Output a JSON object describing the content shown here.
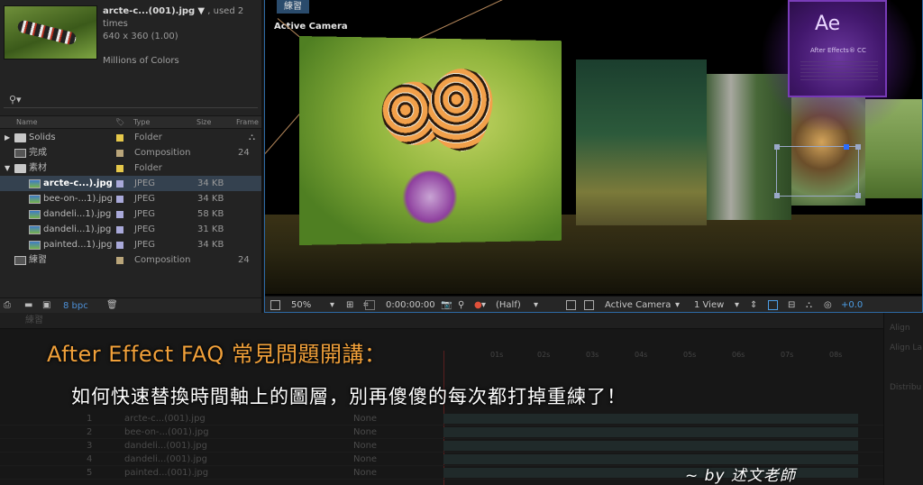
{
  "project": {
    "file_name": "arcte-c...(001).jpg",
    "file_used": ", used 2 times",
    "file_dims": "640 x 360 (1.00)",
    "file_colors": "Millions of Colors",
    "search_icon": "search-icon",
    "columns": {
      "name": "Name",
      "type": "Type",
      "size": "Size",
      "frame": "Frame"
    },
    "items": [
      {
        "name": "Solids",
        "type": "Folder",
        "size": "",
        "frame": "",
        "kind": "folder",
        "label_color": "#e6c84a",
        "expanded": false
      },
      {
        "name": "完成",
        "type": "Composition",
        "size": "",
        "frame": "24",
        "kind": "comp",
        "label_color": "#b9a57a"
      },
      {
        "name": "素材",
        "type": "Folder",
        "size": "",
        "frame": "",
        "kind": "folder",
        "label_color": "#e6c84a",
        "expanded": true
      },
      {
        "name": "arcte-c...).jpg",
        "type": "JPEG",
        "size": "34 KB",
        "frame": "",
        "kind": "jpeg",
        "label_color": "#a9a9d9",
        "selected": true
      },
      {
        "name": "bee-on-...1).jpg",
        "type": "JPEG",
        "size": "34 KB",
        "frame": "",
        "kind": "jpeg",
        "label_color": "#a9a9d9"
      },
      {
        "name": "dandeli...1).jpg",
        "type": "JPEG",
        "size": "58 KB",
        "frame": "",
        "kind": "jpeg",
        "label_color": "#a9a9d9"
      },
      {
        "name": "dandeli...1).jpg",
        "type": "JPEG",
        "size": "31 KB",
        "frame": "",
        "kind": "jpeg",
        "label_color": "#a9a9d9"
      },
      {
        "name": "painted...1).jpg",
        "type": "JPEG",
        "size": "34 KB",
        "frame": "",
        "kind": "jpeg",
        "label_color": "#a9a9d9"
      },
      {
        "name": "練習",
        "type": "Composition",
        "size": "",
        "frame": "24",
        "kind": "comp",
        "label_color": "#b9a57a"
      }
    ],
    "bpc": "8 bpc"
  },
  "viewer": {
    "tab_label": "練習",
    "camera_label": "Active Camera",
    "ae_logo": "Ae",
    "ae_product": "After Effects® CC",
    "toolbar": {
      "zoom": "50%",
      "timecode": "0:00:00:00",
      "resolution": "(Half)",
      "camera": "Active Camera",
      "views": "1 View",
      "exposure": "+0.0"
    }
  },
  "timeline": {
    "layers": [
      {
        "num": "1",
        "name": "arcte-c...(001).jpg",
        "parent": "None"
      },
      {
        "num": "2",
        "name": "bee-on-...(001).jpg",
        "parent": "None"
      },
      {
        "num": "3",
        "name": "dandeli...(001).jpg",
        "parent": "None"
      },
      {
        "num": "4",
        "name": "dandeli...(001).jpg",
        "parent": "None"
      },
      {
        "num": "5",
        "name": "painted...(001).jpg",
        "parent": "None"
      }
    ],
    "side_labels": [
      "Align",
      "Align La",
      "Distribu"
    ]
  },
  "overlay": {
    "title": "After Effect FAQ 常見問題開講：",
    "subtitle": "如何快速替換時間軸上的圖層，別再傻傻的每次都打掉重練了！",
    "byline": "~ by 述文老師"
  },
  "colors": {
    "title_orange": "#f0a03a",
    "panel_blue": "#2d6aa6",
    "selection": "#34414f"
  }
}
